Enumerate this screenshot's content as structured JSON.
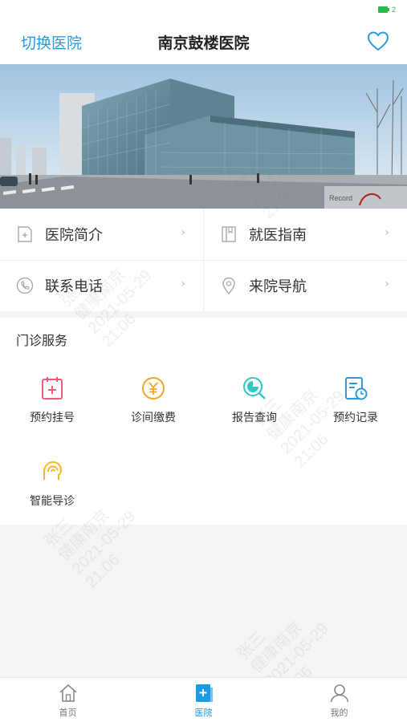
{
  "status_bar": {
    "battery_label": "2",
    "battery_color": "#2db84d"
  },
  "nav": {
    "switch_label": "切换医院",
    "title": "南京鼓楼医院",
    "favorite_icon": "heart-outline-icon",
    "accent": "#2a9be0"
  },
  "banner": {
    "image_desc_icon": "hospital-building-photo"
  },
  "info": {
    "items": [
      {
        "label": "医院简介",
        "icon": "document-plus-icon"
      },
      {
        "label": "就医指南",
        "icon": "book-icon"
      },
      {
        "label": "联系电话",
        "icon": "phone-icon"
      },
      {
        "label": "来院导航",
        "icon": "location-pin-icon"
      }
    ],
    "arrow": "›"
  },
  "services": {
    "title": "门诊服务",
    "items": [
      {
        "label": "预约挂号",
        "icon": "calendar-plus-icon",
        "color": "#f25b78"
      },
      {
        "label": "诊间缴费",
        "icon": "yuan-coin-icon",
        "color": "#f5a623"
      },
      {
        "label": "报告查询",
        "icon": "report-search-icon",
        "color": "#2ec6c6"
      },
      {
        "label": "预约记录",
        "icon": "record-clock-icon",
        "color": "#2a9be0"
      },
      {
        "label": "智能导诊",
        "icon": "smart-guide-head-icon",
        "color": "#f5b823"
      }
    ]
  },
  "watermark": {
    "name": "张三",
    "app": "健康南京",
    "date": "2021-05-29",
    "time": "21:06"
  },
  "tabs": [
    {
      "label": "首页",
      "icon": "home-icon",
      "active": false
    },
    {
      "label": "医院",
      "icon": "hospital-icon",
      "active": true
    },
    {
      "label": "我的",
      "icon": "user-icon",
      "active": false
    }
  ]
}
